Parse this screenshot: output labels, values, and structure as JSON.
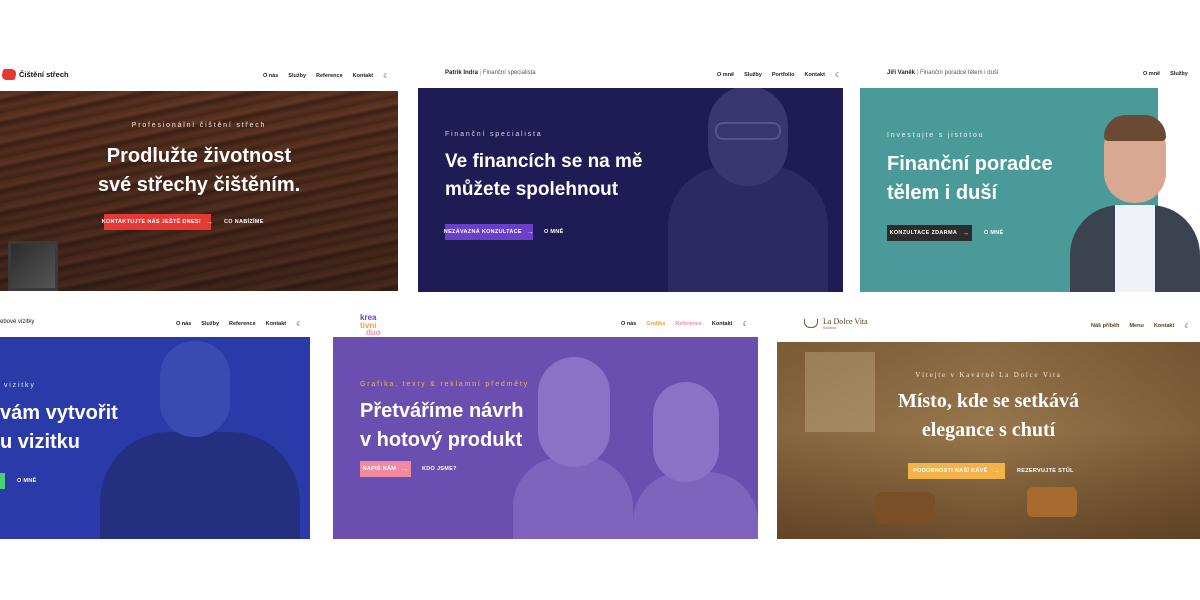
{
  "cards": {
    "roof": {
      "logo_text": "Čištění střech",
      "nav": [
        "O nás",
        "Služby",
        "Reference",
        "Kontakt"
      ],
      "eyebrow": "Profesionální čištění střech",
      "headline1": "Prodlužte životnost",
      "headline2": "své střechy čištěním.",
      "cta": "Kontaktujte nás ještě dnes!",
      "secondary": "Co nabízíme",
      "accent": "#e53935"
    },
    "patrik": {
      "brand_name": "Patrik Indra",
      "brand_sep": "|",
      "brand_role": "Finanční specialista",
      "nav": [
        "O mně",
        "Služby",
        "Portfolio",
        "Kontakt"
      ],
      "eyebrow": "Finanční specialista",
      "headline1": "Ve financích se na mě",
      "headline2": "můžete spolehnout",
      "cta": "Nezávazná konzultace",
      "secondary": "O mně",
      "accent": "#6a3fc9"
    },
    "jiri": {
      "brand_name": "Jiří Vaněk",
      "brand_sep": "|",
      "brand_role": "Finanční poradce tělem i duší",
      "nav": [
        "O mně",
        "Služby"
      ],
      "eyebrow": "Investujte s jistotou",
      "headline1": "Finanční poradce",
      "headline2": "tělem i duší",
      "cta": "Konzultace zdarma",
      "secondary": "O mně",
      "accent": "#4a9a99"
    },
    "vizitky": {
      "brand_partial": "ebové vizitky",
      "nav": [
        "O nás",
        "Služby",
        "Reference",
        "Kontakt"
      ],
      "eyebrow": "vizitky",
      "headline1": "vám vytvořit",
      "headline2": "u vizitku",
      "secondary": "O mně",
      "accent": "#4ad07a"
    },
    "kreativ": {
      "logo_line1": "krea",
      "logo_line2": "tivní",
      "logo_line3": "duo",
      "nav": [
        "O nás",
        "Grafika",
        "Reference",
        "Kontakt"
      ],
      "eyebrow": "Grafika, texty & reklamní předměty",
      "headline1": "Přetváříme návrh",
      "headline2": "v hotový produkt",
      "cta": "Napiš nám",
      "secondary": "Kdo jsme?",
      "accent": "#f08aa0"
    },
    "cafe": {
      "brand": "La Dolce Vita",
      "brand_sub": "Kavárna",
      "nav": [
        "Náš příběh",
        "Menu",
        "Kontakt"
      ],
      "eyebrow": "Vítejte v Kavárně La Dolce Vita",
      "headline1": "Místo, kde se setkává",
      "headline2": "elegance s chutí",
      "cta": "Podobnosti naší kávě",
      "secondary": "Rezervujte stůl",
      "accent": "#f2b44a"
    }
  },
  "icons": {
    "arrow": "→",
    "theme_toggle": "☾"
  }
}
